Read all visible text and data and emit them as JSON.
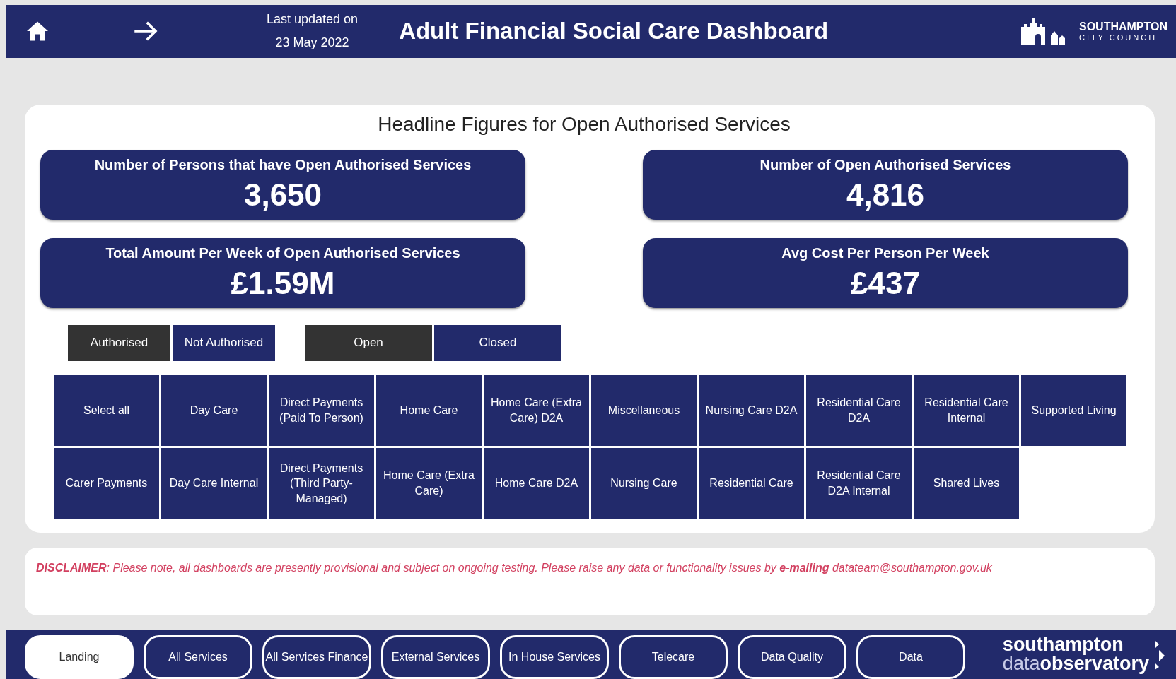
{
  "header": {
    "updated_label": "Last updated on",
    "updated_date": "23 May 2022",
    "title": "Adult Financial Social Care Dashboard",
    "logo_name": "SOUTHAMPTON",
    "logo_sub": "CITY COUNCIL"
  },
  "headline": {
    "title": "Headline Figures for Open Authorised Services",
    "kpis": [
      {
        "label": "Number of Persons that have Open Authorised Services",
        "value": "3,650"
      },
      {
        "label": "Number of Open Authorised Services",
        "value": "4,816"
      },
      {
        "label": "Total Amount Per Week of Open Authorised Services",
        "value": "£1.59M"
      },
      {
        "label": "Avg Cost Per Person Per Week",
        "value": "£437"
      }
    ],
    "status_toggle": [
      {
        "label": "Authorised",
        "selected": true
      },
      {
        "label": "Not Authorised",
        "selected": false
      }
    ],
    "open_toggle": [
      {
        "label": "Open",
        "selected": true
      },
      {
        "label": "Closed",
        "selected": false
      }
    ],
    "service_slicer": [
      {
        "label": "Select all",
        "selected": false
      },
      {
        "label": "Day Care",
        "selected": false
      },
      {
        "label": "Direct Payments (Paid To Person)",
        "selected": false
      },
      {
        "label": "Home Care",
        "selected": false
      },
      {
        "label": "Home Care (Extra Care) D2A",
        "selected": false
      },
      {
        "label": "Miscellaneous",
        "selected": false
      },
      {
        "label": "Nursing Care D2A",
        "selected": false
      },
      {
        "label": "Residential Care D2A",
        "selected": false
      },
      {
        "label": "Residential Care Internal",
        "selected": false
      },
      {
        "label": "Supported Living",
        "selected": false
      },
      {
        "label": "Carer Payments",
        "selected": false
      },
      {
        "label": "Day Care Internal",
        "selected": false
      },
      {
        "label": "Direct Payments (Third Party-Managed)",
        "selected": false
      },
      {
        "label": "Home Care (Extra Care)",
        "selected": false
      },
      {
        "label": "Home Care D2A",
        "selected": false
      },
      {
        "label": "Nursing Care",
        "selected": false
      },
      {
        "label": "Residential Care",
        "selected": false
      },
      {
        "label": "Residential Care D2A Internal",
        "selected": false
      },
      {
        "label": "Shared Lives",
        "selected": false
      }
    ]
  },
  "disclaimer": "**DISCLAIMER**: Please note, all dashboards are presently provisional and subject on ongoing testing. Please raise any data or functionality issues by **e-mailing** datateam@southampton.gov.uk",
  "nav": [
    {
      "label": "Landing",
      "selected": true
    },
    {
      "label": "All Services",
      "selected": false
    },
    {
      "label": "All Services Finance",
      "selected": false
    },
    {
      "label": "External Services",
      "selected": false
    },
    {
      "label": "In House Services",
      "selected": false
    },
    {
      "label": "Telecare",
      "selected": false
    },
    {
      "label": "Data Quality",
      "selected": false
    },
    {
      "label": "Data",
      "selected": false
    }
  ],
  "footer_logo": {
    "line1": "southampton",
    "line2_a": "data",
    "line2_b": "observatory"
  }
}
